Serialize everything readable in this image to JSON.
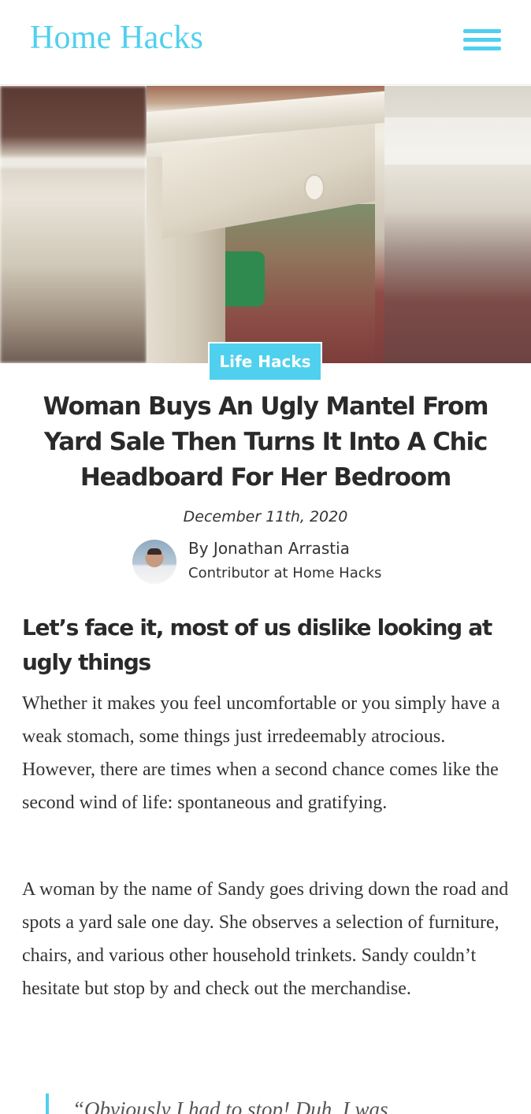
{
  "header": {
    "logo": "Home Hacks",
    "menu_icon": "hamburger-menu-icon"
  },
  "colors": {
    "accent": "#4fd0ee",
    "text": "#2a2a2a"
  },
  "article": {
    "category": "Life Hacks",
    "title": "Woman Buys An Ugly Mantel From Yard Sale Then Turns It Into A Chic Headboard For Her Bedroom",
    "date": "December 11th, 2020",
    "author": {
      "byline": "By Jonathan Arrastia",
      "role": "Contributor at Home Hacks"
    },
    "subheading": "Let’s face it, most of us dislike looking at ugly things",
    "paragraphs": [
      "Whether it makes you feel uncomfortable or you simply have a weak stomach, some things just irredeemably atrocious. However, there are times when a second chance comes like the second wind of life: spontaneous and gratifying.",
      "A woman by the name of Sandy goes driving down the road and spots a yard sale one day. She observes a selection of furniture, chairs, and various other household trinkets. Sandy couldn’t hesitate but stop by and check out the merchandise."
    ],
    "quote": "“Obviously I had to stop! Duh. I was"
  }
}
